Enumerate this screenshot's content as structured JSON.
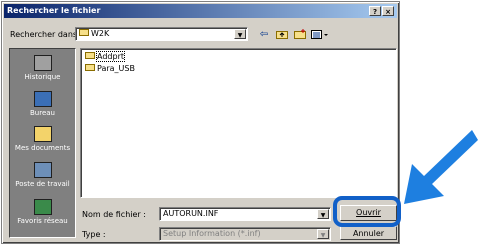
{
  "window": {
    "title": "Rechercher le fichier",
    "help_label": "?",
    "close_label": "×"
  },
  "lookin": {
    "label": "Rechercher dans :",
    "value": "W2K",
    "dropdown_arrow": "▼"
  },
  "toolbar": {
    "icons": [
      "back-icon",
      "up-folder-icon",
      "new-folder-icon",
      "view-menu-icon"
    ]
  },
  "places": [
    {
      "label": "Historique",
      "icon": "history-icon",
      "color": "#a0a0a0"
    },
    {
      "label": "Bureau",
      "icon": "desktop-icon",
      "color": "#3b6fb6"
    },
    {
      "label": "Mes documents",
      "icon": "my-documents-icon",
      "color": "#f3d36a"
    },
    {
      "label": "Poste de travail",
      "icon": "my-computer-icon",
      "color": "#6d8fb8"
    },
    {
      "label": "Favoris réseau",
      "icon": "network-icon",
      "color": "#3a8a4a"
    }
  ],
  "files": [
    {
      "name": "Addprt",
      "selected": true
    },
    {
      "name": "Para_USB",
      "selected": false
    }
  ],
  "filename": {
    "label": "Nom de fichier :",
    "value": "AUTORUN.INF"
  },
  "filetype": {
    "label": "Type :",
    "value": "Setup Information (*.inf)"
  },
  "buttons": {
    "open": "Ouvrir",
    "cancel": "Annuler"
  },
  "colors": {
    "highlight": "#1160c8",
    "arrow": "#1e7fe0",
    "title_bar": "#0a246a"
  }
}
